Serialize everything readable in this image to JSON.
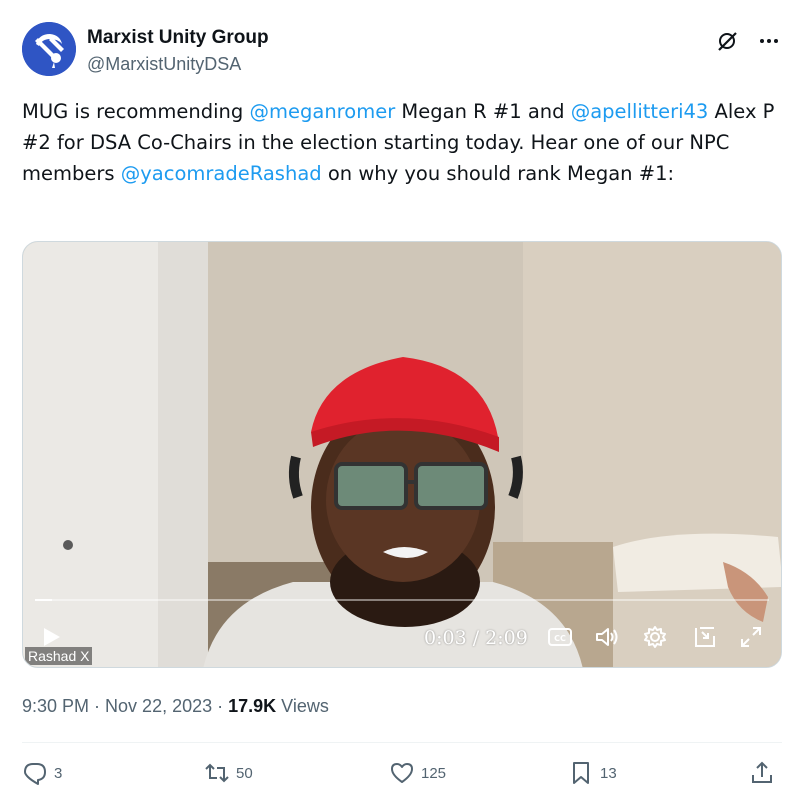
{
  "author": {
    "display_name": "Marxist Unity Group",
    "handle": "@MarxistUnityDSA",
    "avatar_icon": "hammer-sickle-rose-logo",
    "avatar_color": "#2f55c4"
  },
  "tweet": {
    "parts": [
      {
        "text": "MUG is recommending ",
        "mention": false
      },
      {
        "text": "@meganromer",
        "mention": true
      },
      {
        "text": " Megan R #1 and ",
        "mention": false
      },
      {
        "text": "@apellitteri43",
        "mention": true
      },
      {
        "text": " Alex P #2 for DSA Co-Chairs in the election starting today. Hear one of our NPC members ",
        "mention": false
      },
      {
        "text": "@yacomradeRashad",
        "mention": true
      },
      {
        "text": " on why you should rank Megan #1:",
        "mention": false
      }
    ],
    "mention_color": "#1d9bf0"
  },
  "video": {
    "current_time": "0:03",
    "duration": "2:09",
    "time_display": "0:03 / 2:09",
    "progress_fraction": 0.023,
    "watermark": "Rashad X",
    "controls": [
      "play-icon",
      "captions-icon",
      "volume-icon",
      "settings-icon",
      "pip-icon",
      "fullscreen-icon"
    ]
  },
  "meta": {
    "time": "9:30 PM",
    "separator": " · ",
    "date": "Nov 22, 2023",
    "views_count": "17.9K",
    "views_label": " Views"
  },
  "actions": {
    "replies": "3",
    "reposts": "50",
    "likes": "125",
    "bookmarks": "13"
  }
}
